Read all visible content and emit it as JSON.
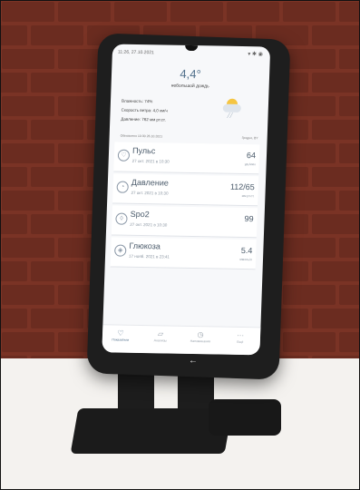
{
  "status_bar": {
    "time": "11:26, 27.10.2021"
  },
  "weather": {
    "temperature": "4,4°",
    "condition": "небольшой дождь",
    "humidity": "Влажность: 74%",
    "wind": "Скорость ветра: 4,0 км/ч",
    "pressure": "Давление: 762 мм рт.ст.",
    "updated": "Обновлено 10:30 26.10.2021",
    "location": "Гродно, BY"
  },
  "metrics": [
    {
      "name": "Пульс",
      "date": "27 окт. 2021 в 10:30",
      "value": "64",
      "unit": "уд./мин",
      "icon": "heart-icon"
    },
    {
      "name": "Давление",
      "date": "27 окт. 2021 в 10:30",
      "value": "112/65",
      "unit": "мм рт.ст.",
      "icon": "gauge-icon"
    },
    {
      "name": "Spo2",
      "date": "27 окт. 2021 в 10:30",
      "value": "99",
      "unit": "",
      "icon": "drop-icon"
    },
    {
      "name": "Глюкоза",
      "date": "17 нояб. 2021 в 23:41",
      "value": "5.4",
      "unit": "ммоль/л",
      "icon": "glucose-icon"
    }
  ],
  "nav": [
    {
      "label": "Показатели",
      "icon": "pulse-icon"
    },
    {
      "label": "Анализы",
      "icon": "chart-icon"
    },
    {
      "label": "Напоминания",
      "icon": "clock-icon"
    },
    {
      "label": "Ещё",
      "icon": "more-icon"
    }
  ]
}
